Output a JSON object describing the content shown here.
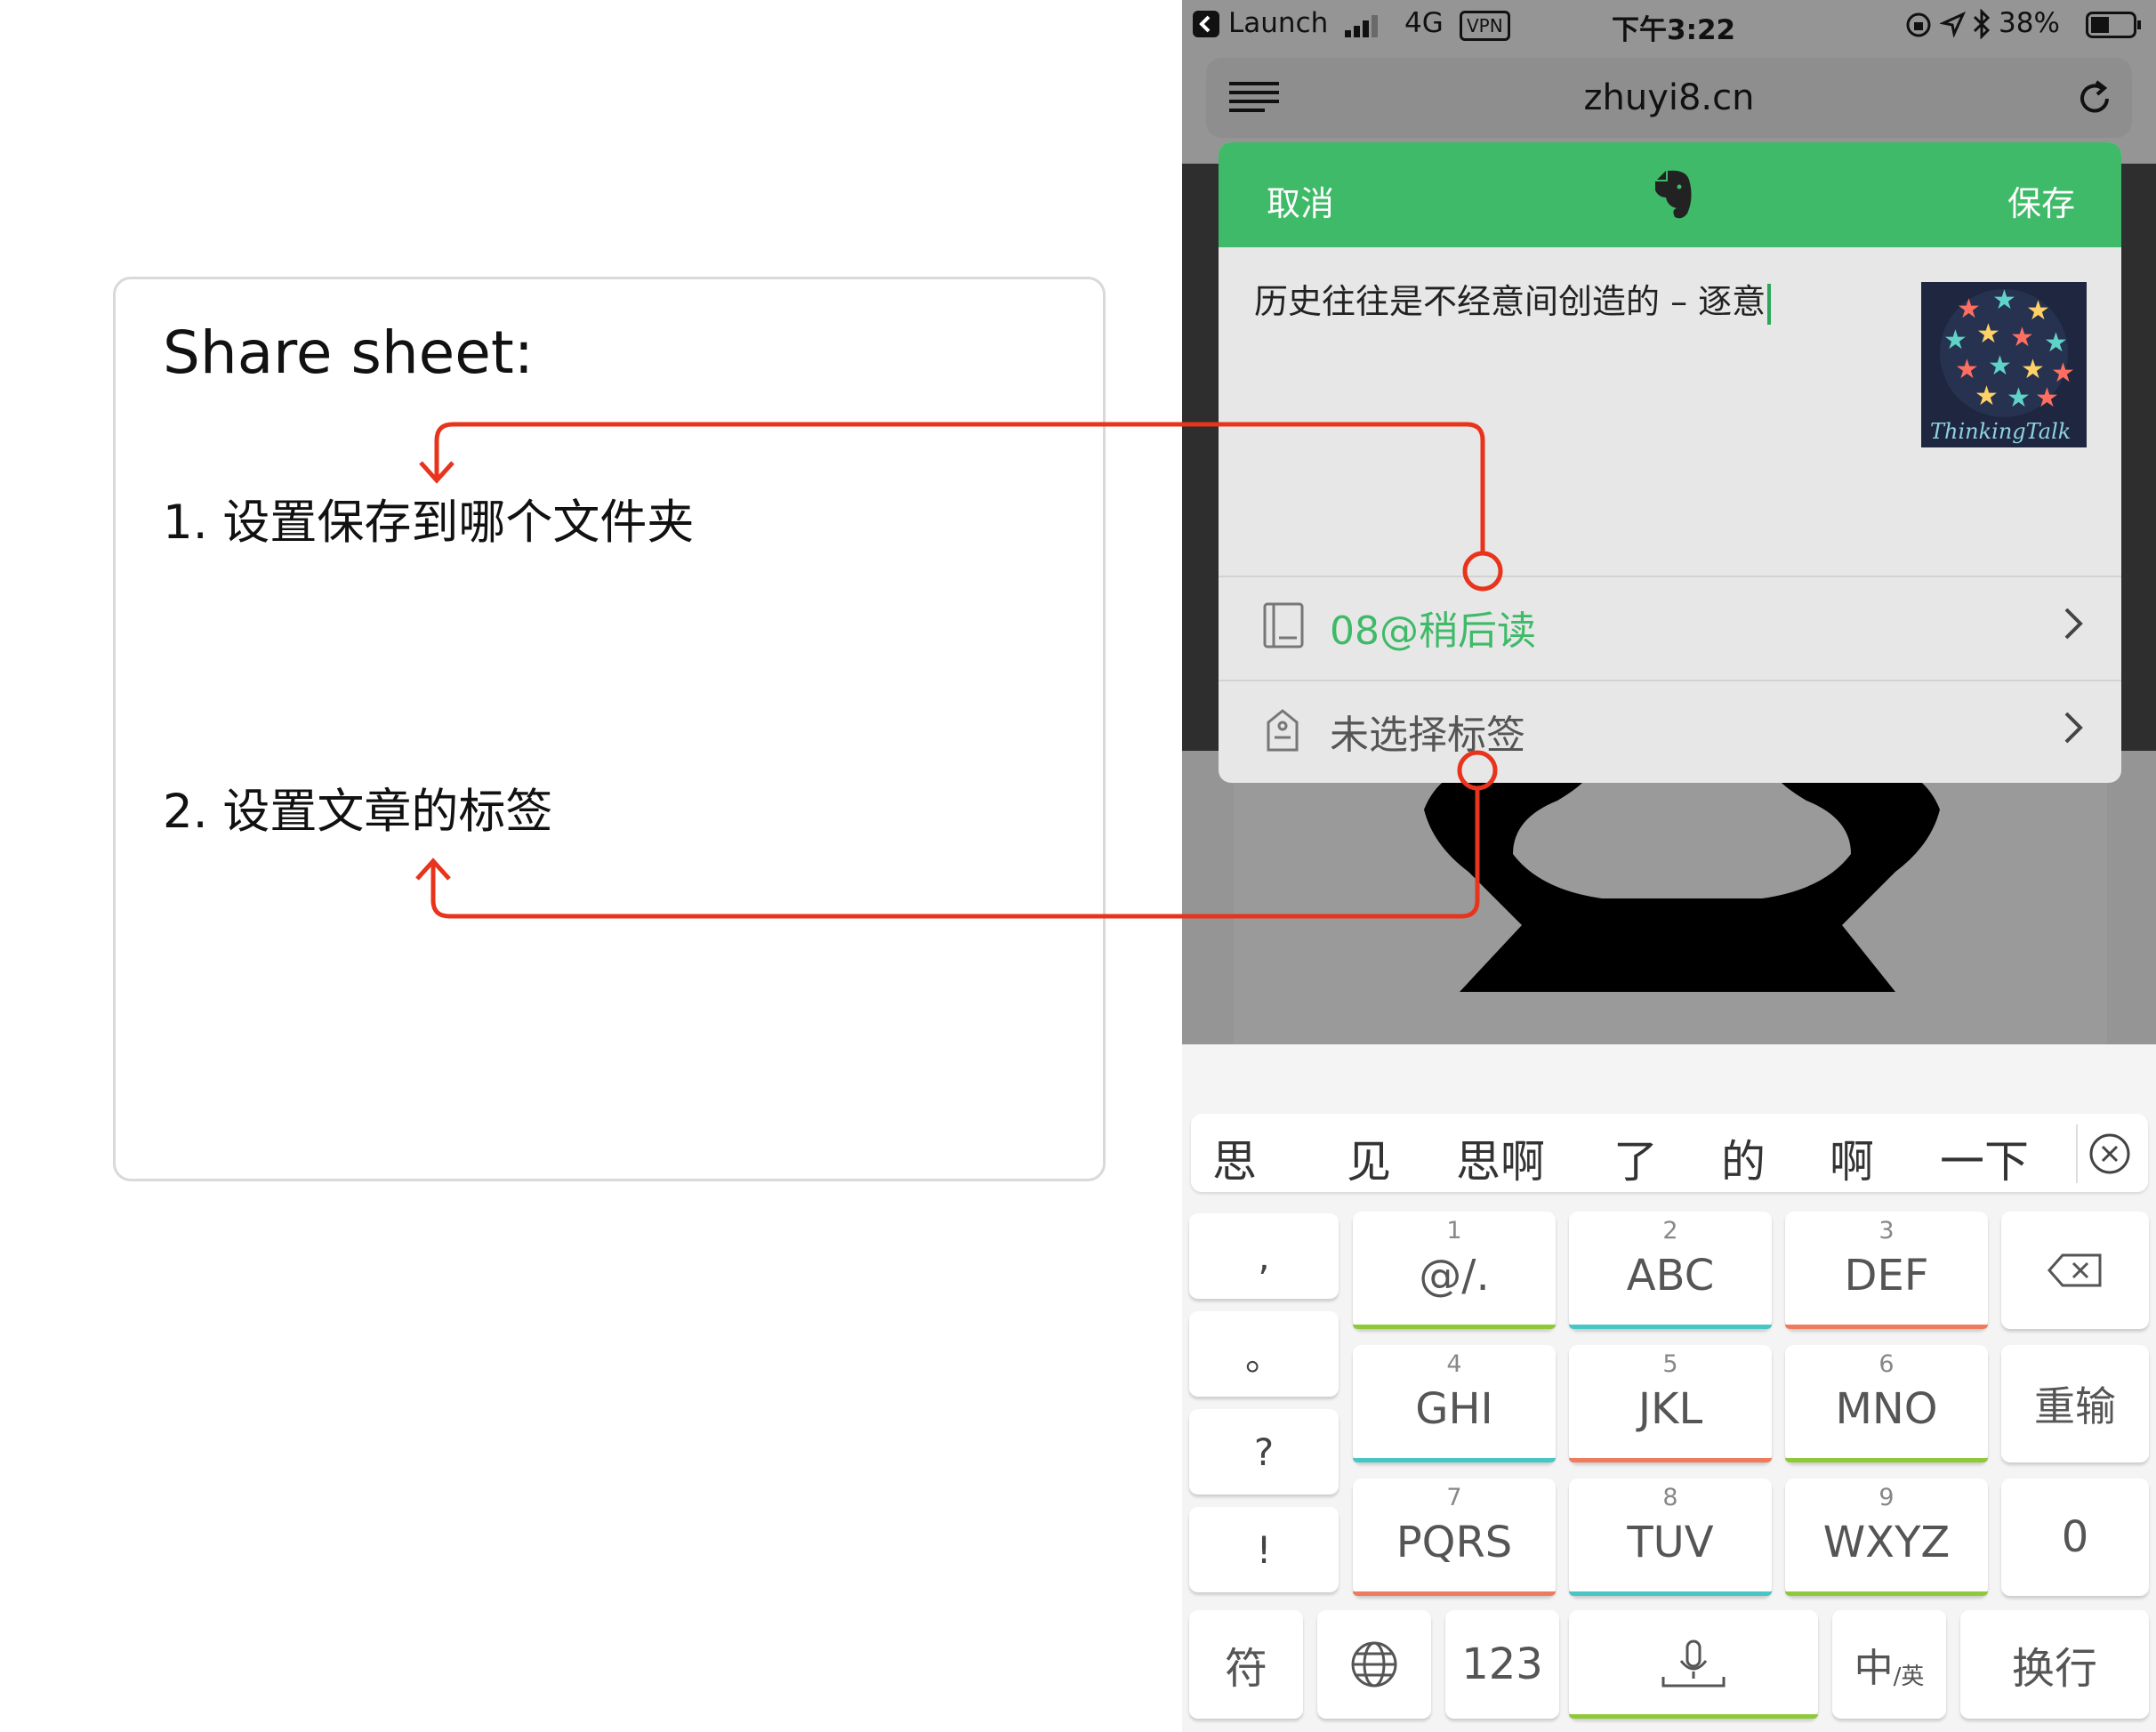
{
  "annotation": {
    "title": "Share sheet:",
    "step1": "1. 设置保存到哪个文件夹",
    "step2": "2. 设置文章的标签"
  },
  "statusbar": {
    "back_app": "Launch",
    "network": "4G",
    "vpn": "VPN",
    "time": "下午3:22",
    "battery": "38%"
  },
  "browser": {
    "url": "zhuyi8.cn"
  },
  "share_sheet": {
    "cancel": "取消",
    "save": "保存",
    "note_title": "历史往往是不经意间创造的 – 逐意",
    "thumbnail_text": "ThinkingTalk",
    "notebook": "08@稍后读",
    "tags": "未选择标签"
  },
  "keyboard": {
    "candidates": [
      "思",
      "见",
      "思啊",
      "了",
      "的",
      "啊",
      "一下"
    ],
    "punctuation": [
      ",",
      "。",
      "?",
      "!"
    ],
    "keys": [
      {
        "num": "1",
        "label": "@/."
      },
      {
        "num": "2",
        "label": "ABC"
      },
      {
        "num": "3",
        "label": "DEF"
      },
      {
        "num": "4",
        "label": "GHI"
      },
      {
        "num": "5",
        "label": "JKL"
      },
      {
        "num": "6",
        "label": "MNO"
      },
      {
        "num": "7",
        "label": "PQRS"
      },
      {
        "num": "8",
        "label": "TUV"
      },
      {
        "num": "9",
        "label": "WXYZ"
      }
    ],
    "reenter": "重输",
    "zero": "0",
    "symbols": "符",
    "numbers": "123",
    "lang_main": "中",
    "lang_sub": "/英",
    "enter": "换行"
  },
  "colors": {
    "brand_green": "#3fba68",
    "arrow_red": "#e8341c",
    "accent_teal": "#48c6c6",
    "accent_lime": "#8fc93a",
    "accent_coral": "#f07a5c"
  }
}
